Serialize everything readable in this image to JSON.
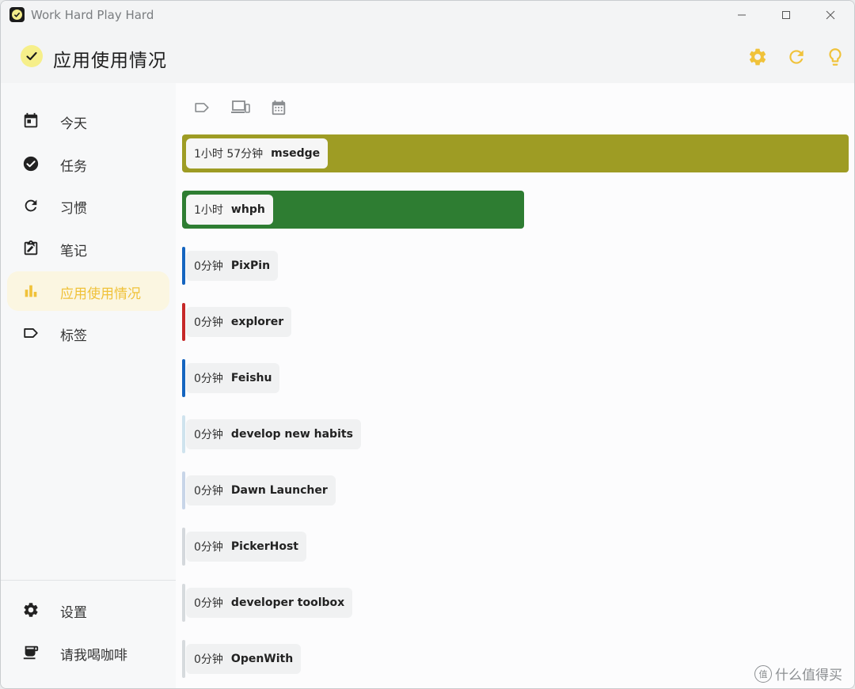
{
  "window": {
    "title": "Work Hard Play Hard"
  },
  "header": {
    "title": "应用使用情况",
    "actions": [
      {
        "name": "settings-icon"
      },
      {
        "name": "refresh-icon"
      },
      {
        "name": "lightbulb-icon"
      }
    ]
  },
  "sidebar": {
    "items": [
      {
        "label": "今天",
        "icon": "calendar-today-icon"
      },
      {
        "label": "任务",
        "icon": "check-circle-icon"
      },
      {
        "label": "习惯",
        "icon": "refresh-icon"
      },
      {
        "label": "笔记",
        "icon": "note-edit-icon"
      },
      {
        "label": "应用使用情况",
        "icon": "bar-chart-icon",
        "active": true
      },
      {
        "label": "标签",
        "icon": "tag-icon"
      }
    ],
    "footer": [
      {
        "label": "设置",
        "icon": "gear-icon"
      },
      {
        "label": "请我喝咖啡",
        "icon": "coffee-cup-icon"
      }
    ]
  },
  "filters": [
    {
      "name": "tag-filter-icon"
    },
    {
      "name": "device-filter-icon"
    },
    {
      "name": "date-filter-icon"
    }
  ],
  "usage": {
    "max_minutes": 117,
    "items": [
      {
        "duration": "1小时 57分钟",
        "name": "msedge",
        "minutes": 117,
        "color": "#9e9c24"
      },
      {
        "duration": "1小时",
        "name": "whph",
        "minutes": 60,
        "color": "#2e7d32"
      },
      {
        "duration": "0分钟",
        "name": "PixPin",
        "minutes": 0,
        "color": "#1565c0"
      },
      {
        "duration": "0分钟",
        "name": "explorer",
        "minutes": 0,
        "color": "#c62828"
      },
      {
        "duration": "0分钟",
        "name": "Feishu",
        "minutes": 0,
        "color": "#1565c0"
      },
      {
        "duration": "0分钟",
        "name": "develop new habits",
        "minutes": 0,
        "color": "#cfe3ee"
      },
      {
        "duration": "0分钟",
        "name": "Dawn Launcher",
        "minutes": 0,
        "color": "#c8d5e8"
      },
      {
        "duration": "0分钟",
        "name": "PickerHost",
        "minutes": 0,
        "color": "#d4d8dc"
      },
      {
        "duration": "0分钟",
        "name": "developer toolbox",
        "minutes": 0,
        "color": "#d6dadd"
      },
      {
        "duration": "0分钟",
        "name": "OpenWith",
        "minutes": 0,
        "color": "#d6dadd"
      }
    ]
  },
  "watermark": {
    "text": "什么值得买",
    "badge": "值"
  },
  "colors": {
    "accent": "#f0c23a",
    "active_bg": "#fbf6e1"
  }
}
